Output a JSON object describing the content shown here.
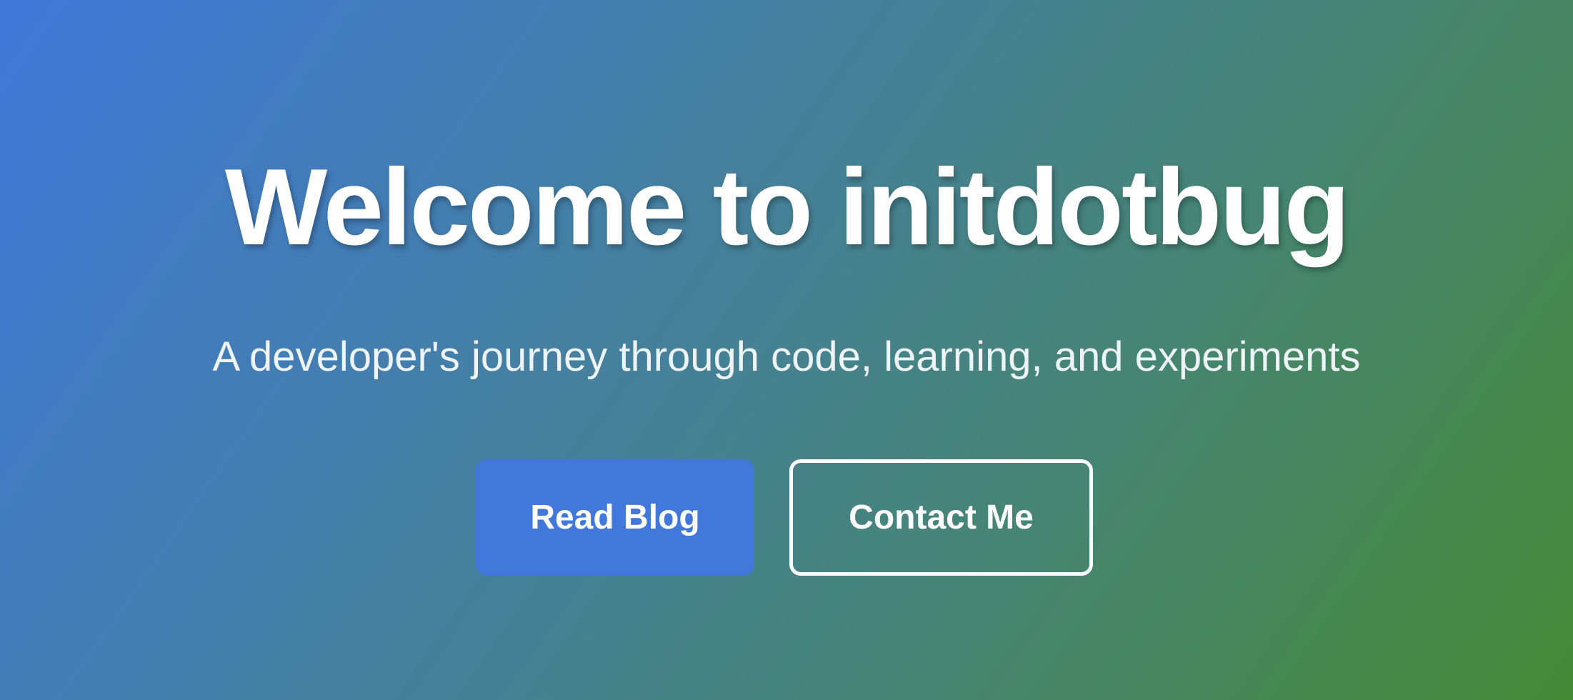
{
  "hero": {
    "title": "Welcome to initdotbug",
    "subtitle": "A developer's journey through code, learning, and experiments",
    "buttons": {
      "primary_label": "Read Blog",
      "secondary_label": "Contact Me"
    }
  },
  "colors": {
    "gradient_start": "#3f78da",
    "gradient_end": "#438a35",
    "primary_button": "#4278dc",
    "text": "#ffffff"
  }
}
